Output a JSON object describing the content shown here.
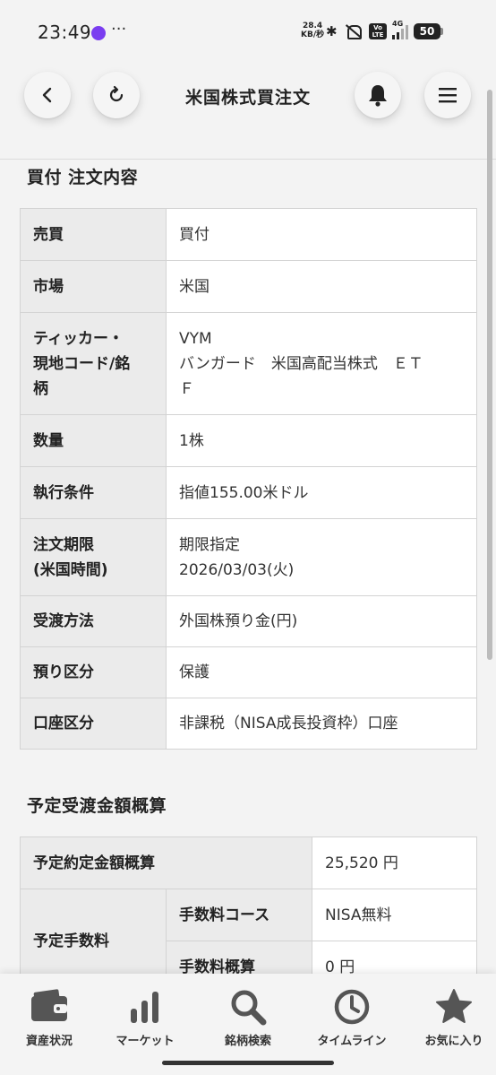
{
  "status_bar": {
    "time": "23:49",
    "more": "···",
    "speed_value": "28.4",
    "speed_unit": "KB/秒",
    "volte": "Vo LTE",
    "network": "4G",
    "battery": "50"
  },
  "header": {
    "title": "米国株式買注文"
  },
  "order_section": {
    "title": "買付 注文内容",
    "rows": [
      {
        "label": "売買",
        "value": "買付"
      },
      {
        "label": "市場",
        "value": "米国"
      },
      {
        "label": "ティッカー・\n現地コード/銘\n柄",
        "value": "VYM\nバンガード　米国高配当株式　ＥＴ\nＦ"
      },
      {
        "label": "数量",
        "value": "1株"
      },
      {
        "label": "執行条件",
        "value": "指値155.00米ドル"
      },
      {
        "label": "注文期限\n(米国時間)",
        "value": "期限指定\n2026/03/03(火)"
      },
      {
        "label": "受渡方法",
        "value": "外国株預り金(円)"
      },
      {
        "label": "預り区分",
        "value": "保護"
      },
      {
        "label": "口座区分",
        "value": "非課税（NISA成長投資枠）口座"
      }
    ]
  },
  "amount_section": {
    "title": "予定受渡金額概算",
    "contract_label": "予定約定金額概算",
    "contract_value": "25,520 円",
    "fee_label": "予定手数料",
    "fee_course_label": "手数料コース",
    "fee_course_value": "NISA無料",
    "fee_estimate_label": "手数料概算",
    "fee_estimate_value": "0 円"
  },
  "bottom_nav": {
    "items": [
      {
        "label": "資産状況",
        "icon": "wallet-icon"
      },
      {
        "label": "マーケット",
        "icon": "bar-chart-icon"
      },
      {
        "label": "銘柄検索",
        "icon": "search-icon"
      },
      {
        "label": "タイムライン",
        "icon": "clock-icon"
      },
      {
        "label": "お気に入り",
        "icon": "star-icon"
      }
    ]
  },
  "colors": {
    "background": "#f3f3f3",
    "table_header_bg": "#ebebeb",
    "table_border": "#d3d3d3",
    "icon": "#555555"
  }
}
